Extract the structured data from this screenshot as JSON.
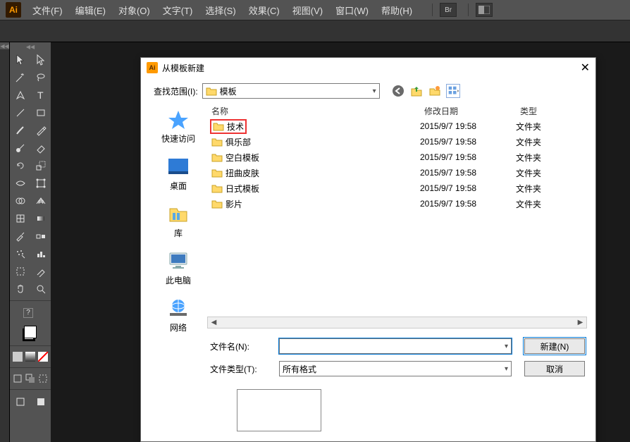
{
  "menu": {
    "items": [
      "文件(F)",
      "编辑(E)",
      "对象(O)",
      "文字(T)",
      "选择(S)",
      "效果(C)",
      "视图(V)",
      "窗口(W)",
      "帮助(H)"
    ],
    "br_label": "Br"
  },
  "dialog": {
    "title": "从模板新建",
    "lookin_label": "查找范围(I):",
    "lookin_value": "模板",
    "columns": {
      "name": "名称",
      "date": "修改日期",
      "type": "类型"
    },
    "places": [
      "快速访问",
      "桌面",
      "库",
      "此电脑",
      "网络"
    ],
    "rows": [
      {
        "name": "技术",
        "date": "2015/9/7 19:58",
        "type": "文件夹",
        "highlight": true
      },
      {
        "name": "俱乐部",
        "date": "2015/9/7 19:58",
        "type": "文件夹"
      },
      {
        "name": "空白模板",
        "date": "2015/9/7 19:58",
        "type": "文件夹"
      },
      {
        "name": "扭曲皮肤",
        "date": "2015/9/7 19:58",
        "type": "文件夹"
      },
      {
        "name": "日式模板",
        "date": "2015/9/7 19:58",
        "type": "文件夹"
      },
      {
        "name": "影片",
        "date": "2015/9/7 19:58",
        "type": "文件夹"
      }
    ],
    "filename_label": "文件名(N):",
    "filetype_label": "文件类型(T):",
    "filetype_value": "所有格式",
    "new_btn": "新建(N)",
    "cancel_btn": "取消"
  }
}
